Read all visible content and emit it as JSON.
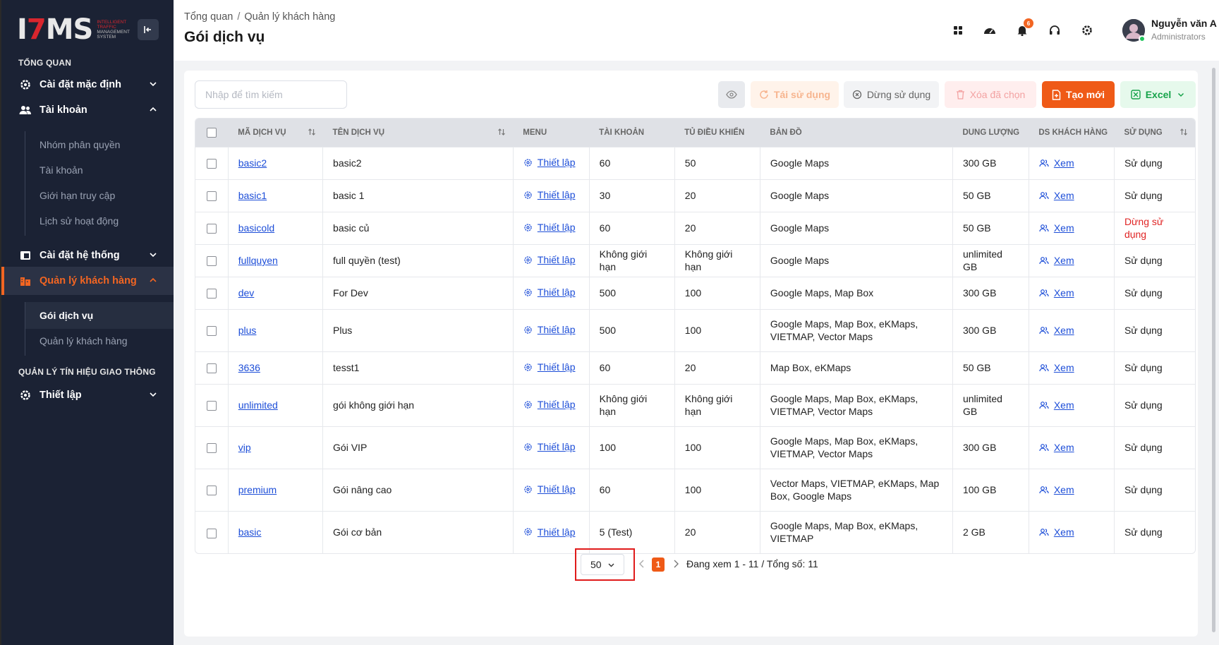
{
  "sidebar": {
    "logo_text": "ITMS",
    "logo_sub": [
      "INTELLIGENT",
      "TRAFFIC",
      "MANAGEMENT",
      "SYSTEM"
    ],
    "section_overview": "TỔNG QUAN",
    "item_default_settings": "Cài đặt mặc định",
    "item_accounts": "Tài khoản",
    "sub_permission_groups": "Nhóm phân quyền",
    "sub_accounts": "Tài khoản",
    "sub_access_limit": "Giới hạn truy cập",
    "sub_activity_history": "Lịch sử hoạt động",
    "item_system_settings": "Cài đặt hệ thống",
    "item_customer_management": "Quản lý khách hàng",
    "sub_service_packages": "Gói dịch vụ",
    "sub_customer_management": "Quản lý khách hàng",
    "section_traffic": "QUẢN LÝ TÍN HIỆU GIAO THÔNG",
    "item_setup": "Thiết lập"
  },
  "header": {
    "breadcrumb": [
      "Tổng quan",
      "Quản lý khách hàng"
    ],
    "title": "Gói dịch vụ",
    "notification_count": "6",
    "user_name": "Nguyễn văn A",
    "user_role": "Administrators"
  },
  "toolbar": {
    "search_placeholder": "Nhập để tìm kiếm",
    "reuse_label": "Tái sử dụng",
    "stop_label": "Dừng sử dụng",
    "delete_selected_label": "Xóa đã chọn",
    "create_label": "Tạo mới",
    "excel_label": "Excel"
  },
  "table": {
    "headers": [
      "MÃ DỊCH VỤ",
      "TÊN DỊCH VỤ",
      "MENU",
      "TÀI KHOẢN",
      "TỦ ĐIỀU KHIỂN",
      "BẢN ĐỒ",
      "DUNG LƯỢNG",
      "DS KHÁCH HÀNG",
      "SỬ DỤNG"
    ],
    "menu_link_label": "Thiết lập",
    "customers_link_label": "Xem",
    "rows": [
      {
        "code": "basic2",
        "name": "basic2",
        "accounts": "60",
        "controllers": "50",
        "maps": "Google Maps",
        "storage": "300 GB",
        "status": "Sử dụng",
        "active": true
      },
      {
        "code": "basic1",
        "name": "basic 1",
        "accounts": "30",
        "controllers": "20",
        "maps": "Google Maps",
        "storage": "50 GB",
        "status": "Sử dụng",
        "active": true
      },
      {
        "code": "basicold",
        "name": "basic củ",
        "accounts": "60",
        "controllers": "20",
        "maps": "Google Maps",
        "storage": "50 GB",
        "status": "Dừng sử dụng",
        "active": false
      },
      {
        "code": "fullquyen",
        "name": "full quyền (test)",
        "accounts": "Không giới hạn",
        "controllers": "Không giới hạn",
        "maps": "Google Maps",
        "storage": "unlimited GB",
        "status": "Sử dụng",
        "active": true
      },
      {
        "code": "dev",
        "name": "For Dev",
        "accounts": "500",
        "controllers": "100",
        "maps": "Google Maps, Map Box",
        "storage": "300 GB",
        "status": "Sử dụng",
        "active": true
      },
      {
        "code": "plus",
        "name": "Plus",
        "accounts": "500",
        "controllers": "100",
        "maps": "Google Maps, Map Box, eKMaps, VIETMAP, Vector Maps",
        "storage": "300 GB",
        "status": "Sử dụng",
        "active": true
      },
      {
        "code": "3636",
        "name": "tesst1",
        "accounts": "60",
        "controllers": "20",
        "maps": "Map Box, eKMaps",
        "storage": "50 GB",
        "status": "Sử dụng",
        "active": true
      },
      {
        "code": "unlimited",
        "name": "gói không giới hạn",
        "accounts": "Không giới hạn",
        "controllers": "Không giới hạn",
        "maps": "Google Maps, Map Box, eKMaps, VIETMAP, Vector Maps",
        "storage": "unlimited GB",
        "status": "Sử dụng",
        "active": true
      },
      {
        "code": "vip",
        "name": "Gói VIP",
        "accounts": "100",
        "controllers": "100",
        "maps": "Google Maps, Map Box, eKMaps, VIETMAP, Vector Maps",
        "storage": "300 GB",
        "status": "Sử dụng",
        "active": true
      },
      {
        "code": "premium",
        "name": "Gói nâng cao",
        "accounts": "60",
        "controllers": "100",
        "maps": "Vector Maps, VIETMAP, eKMaps, Map Box, Google Maps",
        "storage": "100 GB",
        "status": "Sử dụng",
        "active": true
      },
      {
        "code": "basic",
        "name": "Gói cơ bản",
        "accounts": "5 (Test)",
        "controllers": "20",
        "maps": "Google Maps, Map Box, eKMaps, VIETMAP",
        "storage": "2 GB",
        "status": "Sử dụng",
        "active": true
      }
    ]
  },
  "pagination": {
    "page_size": "50",
    "current_page": "1",
    "info": "Đang xem 1 - 11 / Tổng số: 11"
  },
  "colors": {
    "accent": "#ef5a17",
    "sidebar_bg": "#1b2234",
    "link": "#1d4ed8",
    "stopped": "#e02424"
  }
}
